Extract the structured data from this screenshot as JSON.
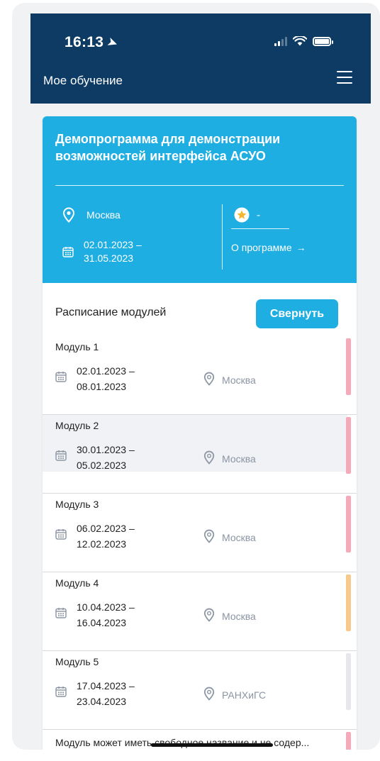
{
  "status_bar": {
    "time": "16:13"
  },
  "header": {
    "title": "Мое обучение",
    "menu_icon": "hamburger-icon"
  },
  "program": {
    "title": "Демопрограмма для демонстрации возможностей интерфейса АСУО",
    "location": "Москва",
    "date_range_line1": "02.01.2023 –",
    "date_range_line2": "31.05.2023",
    "rating": "-",
    "about_label": "О программе",
    "colors": {
      "header_bg": "#1faee2",
      "topbar_bg": "#0d3b63",
      "star": "#f5b731"
    }
  },
  "schedule": {
    "title": "Расписание модулей",
    "collapse_label": "Свернуть",
    "modules": [
      {
        "name": "Модуль 1",
        "date_line1": "02.01.2023 –",
        "date_line2": "08.01.2023",
        "location": "Москва",
        "accent": "#f6a9b9"
      },
      {
        "name": "Модуль 2",
        "date_line1": "30.01.2023 –",
        "date_line2": "05.02.2023",
        "location": "Москва",
        "accent": "#f6a9b9"
      },
      {
        "name": "Модуль 3",
        "date_line1": "06.02.2023 –",
        "date_line2": "12.02.2023",
        "location": "Москва",
        "accent": "#f6a9b9"
      },
      {
        "name": "Модуль 4",
        "date_line1": "10.04.2023 –",
        "date_line2": "16.04.2023",
        "location": "Москва",
        "accent": "#f7c98a"
      },
      {
        "name": "Модуль 5",
        "date_line1": "17.04.2023 –",
        "date_line2": "23.04.2023",
        "location": "РАНХиГС",
        "accent": "#e6e8eb"
      }
    ],
    "last_module": {
      "name": "Модуль может иметь свободное название и не содер...",
      "accent": "#f6a9b9"
    }
  }
}
